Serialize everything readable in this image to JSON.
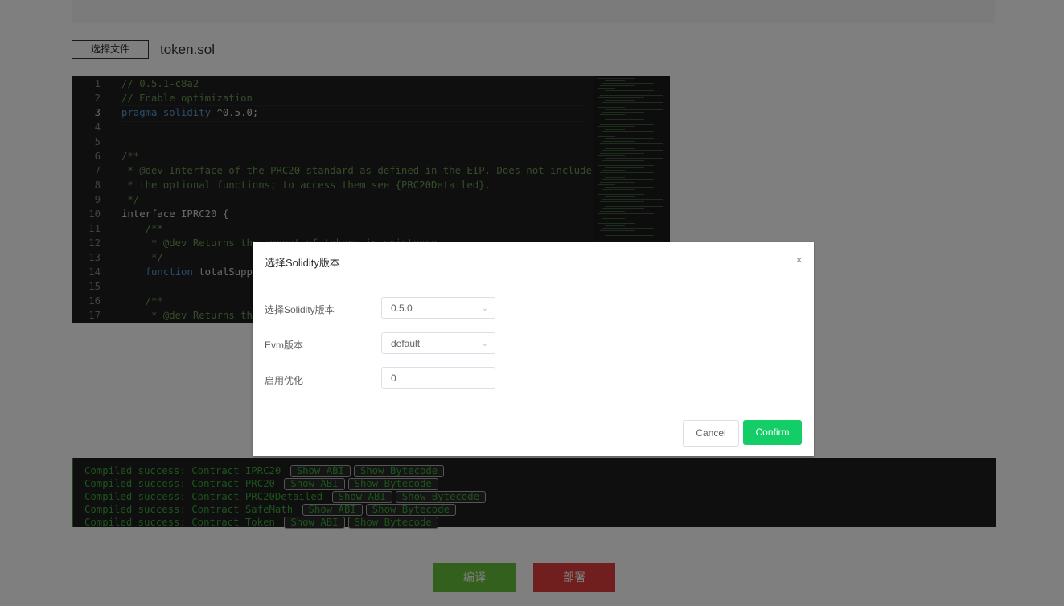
{
  "file": {
    "choose_label": "选择文件",
    "filename": "token.sol"
  },
  "editor": {
    "lines": [
      {
        "n": "1",
        "text": "// 0.5.1-c8a2",
        "kind": "cmt"
      },
      {
        "n": "2",
        "text": "// Enable optimization",
        "kind": "cmt"
      },
      {
        "n": "3",
        "text": "pragma solidity ^0.5.0;",
        "kind": "pragma"
      },
      {
        "n": "4",
        "text": "",
        "kind": "plain"
      },
      {
        "n": "5",
        "text": "",
        "kind": "plain"
      },
      {
        "n": "6",
        "text": "/**",
        "kind": "cmt"
      },
      {
        "n": "7",
        "text": " * @dev Interface of the PRC20 standard as defined in the EIP. Does not include",
        "kind": "cmt"
      },
      {
        "n": "8",
        "text": " * the optional functions; to access them see {PRC20Detailed}.",
        "kind": "cmt"
      },
      {
        "n": "9",
        "text": " */",
        "kind": "cmt"
      },
      {
        "n": "10",
        "text": "interface IPRC20 {",
        "kind": "plain"
      },
      {
        "n": "11",
        "text": "    /**",
        "kind": "cmt"
      },
      {
        "n": "12",
        "text": "     * @dev Returns the amount of tokens in existence.",
        "kind": "cmt"
      },
      {
        "n": "13",
        "text": "     */",
        "kind": "cmt"
      },
      {
        "n": "14",
        "text": "    function totalSuppl",
        "kind": "func"
      },
      {
        "n": "15",
        "text": "",
        "kind": "plain"
      },
      {
        "n": "16",
        "text": "    /**",
        "kind": "cmt"
      },
      {
        "n": "17",
        "text": "     * @dev Returns the",
        "kind": "cmt"
      }
    ],
    "current_line": "3"
  },
  "console": {
    "lines": [
      {
        "text": "Compiled success: Contract IPRC20 ",
        "abi": "Show ABI",
        "bytecode": "Show Bytecode"
      },
      {
        "text": "Compiled success: Contract PRC20 ",
        "abi": "Show ABI",
        "bytecode": "Show Bytecode"
      },
      {
        "text": "Compiled success: Contract PRC20Detailed ",
        "abi": "Show ABI",
        "bytecode": "Show Bytecode"
      },
      {
        "text": "Compiled success: Contract SafeMath ",
        "abi": "Show ABI",
        "bytecode": "Show Bytecode"
      },
      {
        "text": "Compiled success: Contract Token ",
        "abi": "Show ABI",
        "bytecode": "Show Bytecode"
      }
    ]
  },
  "actions": {
    "compile": "编译",
    "deploy": "部署"
  },
  "modal": {
    "title": "选择Solidity版本",
    "close": "×",
    "fields": {
      "solidity_label": "选择Solidity版本",
      "solidity_value": "0.5.0",
      "evm_label": "Evm版本",
      "evm_value": "default",
      "opt_label": "启用优化",
      "opt_value": "0"
    },
    "cancel": "Cancel",
    "confirm": "Confirm"
  },
  "colors": {
    "confirm": "#13ce66",
    "compile": "#67c23a",
    "deploy": "#e03c3c",
    "console_text": "#3aa83a"
  }
}
